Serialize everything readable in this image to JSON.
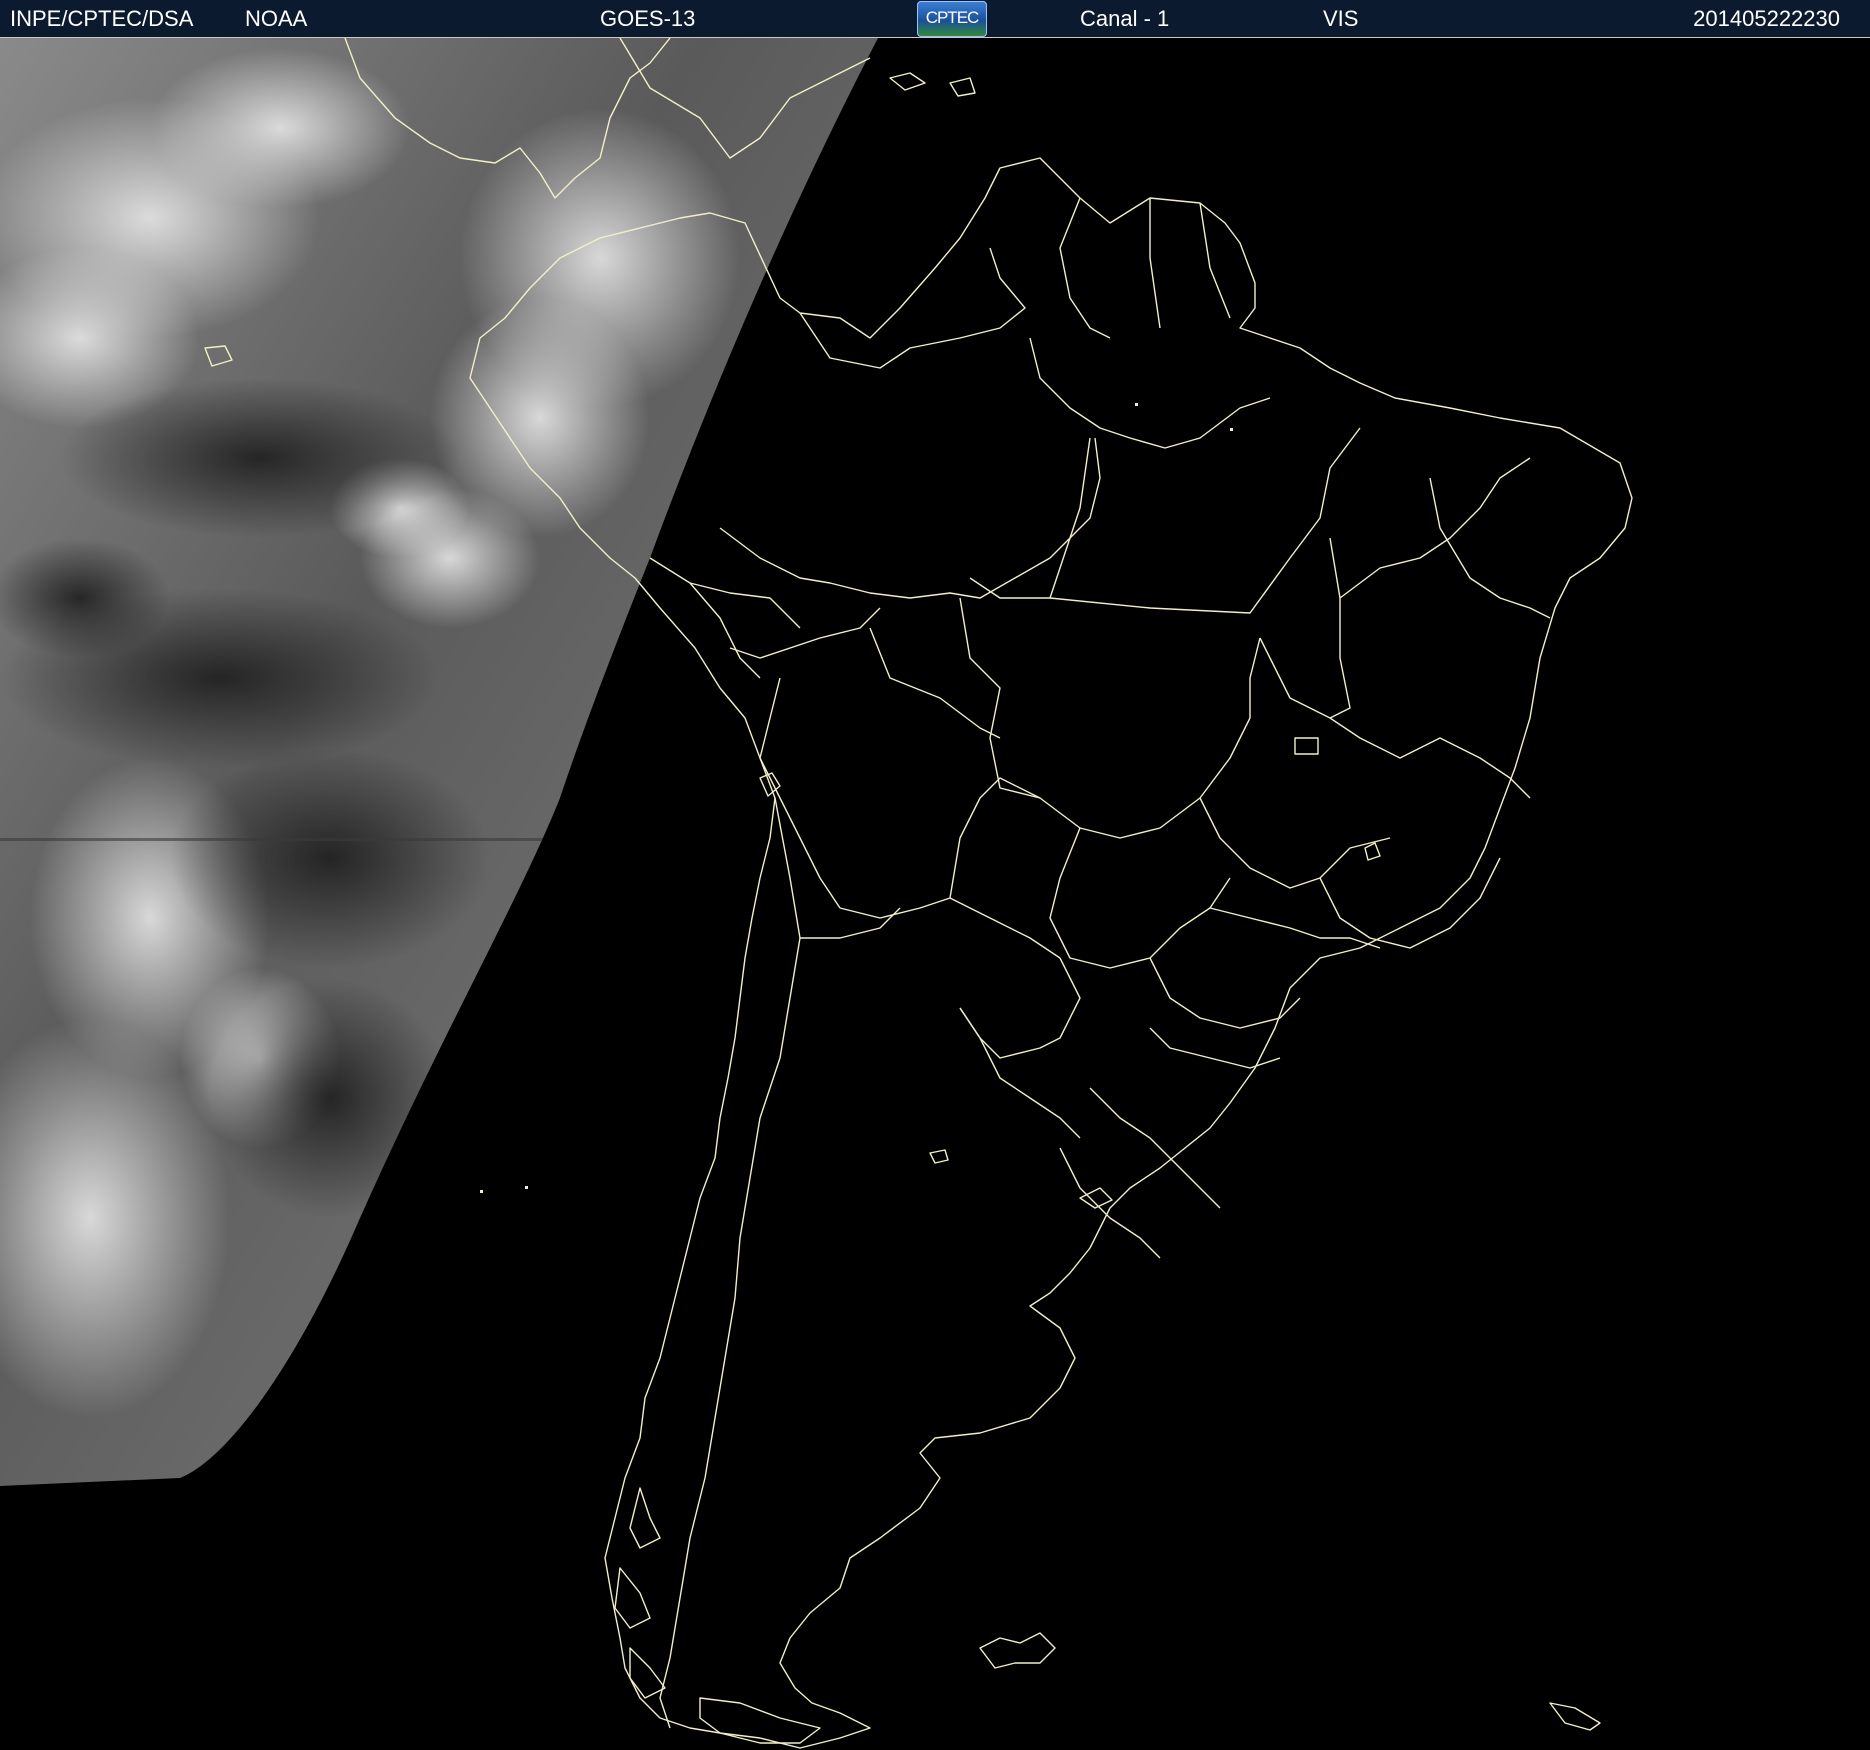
{
  "header": {
    "source": "INPE/CPTEC/DSA",
    "agency": "NOAA",
    "satellite": "GOES-13",
    "logo_text": "CPTEC",
    "channel": "Canal - 1",
    "band": "VIS",
    "timestamp": "201405222230"
  },
  "colors": {
    "background": "#000000",
    "header_bg": "#0b1a2e",
    "coastline": "#f2efc8",
    "cloud_light": "#c9c9c9",
    "cloud_dark": "#2b2b2b"
  },
  "icons": {
    "logo": "cptec-logo-icon"
  }
}
